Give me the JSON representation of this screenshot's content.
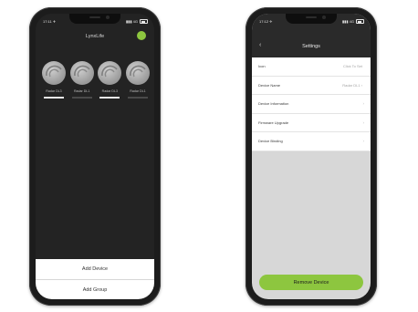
{
  "left_phone": {
    "status": {
      "time": "17:11 ✈",
      "signal": "▮▮▮ 4G"
    },
    "app_title": "LynxLife",
    "devices": [
      {
        "label": "Radar DL3",
        "active": true
      },
      {
        "label": "Radar DL1",
        "active": false
      },
      {
        "label": "Radar DL3",
        "active": true
      },
      {
        "label": "Radar DL1",
        "active": false
      }
    ],
    "actions": {
      "add_device": "Add Device",
      "add_group": "Add Group"
    }
  },
  "right_phone": {
    "status": {
      "time": "17:12 ✈",
      "signal": "▮▮▮ 4G"
    },
    "header": {
      "back": "‹",
      "title": "Settings"
    },
    "rows": [
      {
        "label": "Icon",
        "value": "Click To Set"
      },
      {
        "label": "Device Name",
        "value": "Radar DL1 ›"
      },
      {
        "label": "Device Information",
        "value": ""
      },
      {
        "label": "Firmware Upgrade",
        "value": ""
      },
      {
        "label": "Device Binding",
        "value": ""
      }
    ],
    "chevron": "›",
    "remove_button": "Remove Device"
  },
  "colors": {
    "accent": "#8dc63f",
    "dark_bg": "#232323",
    "panel": "#d7d7d7"
  }
}
